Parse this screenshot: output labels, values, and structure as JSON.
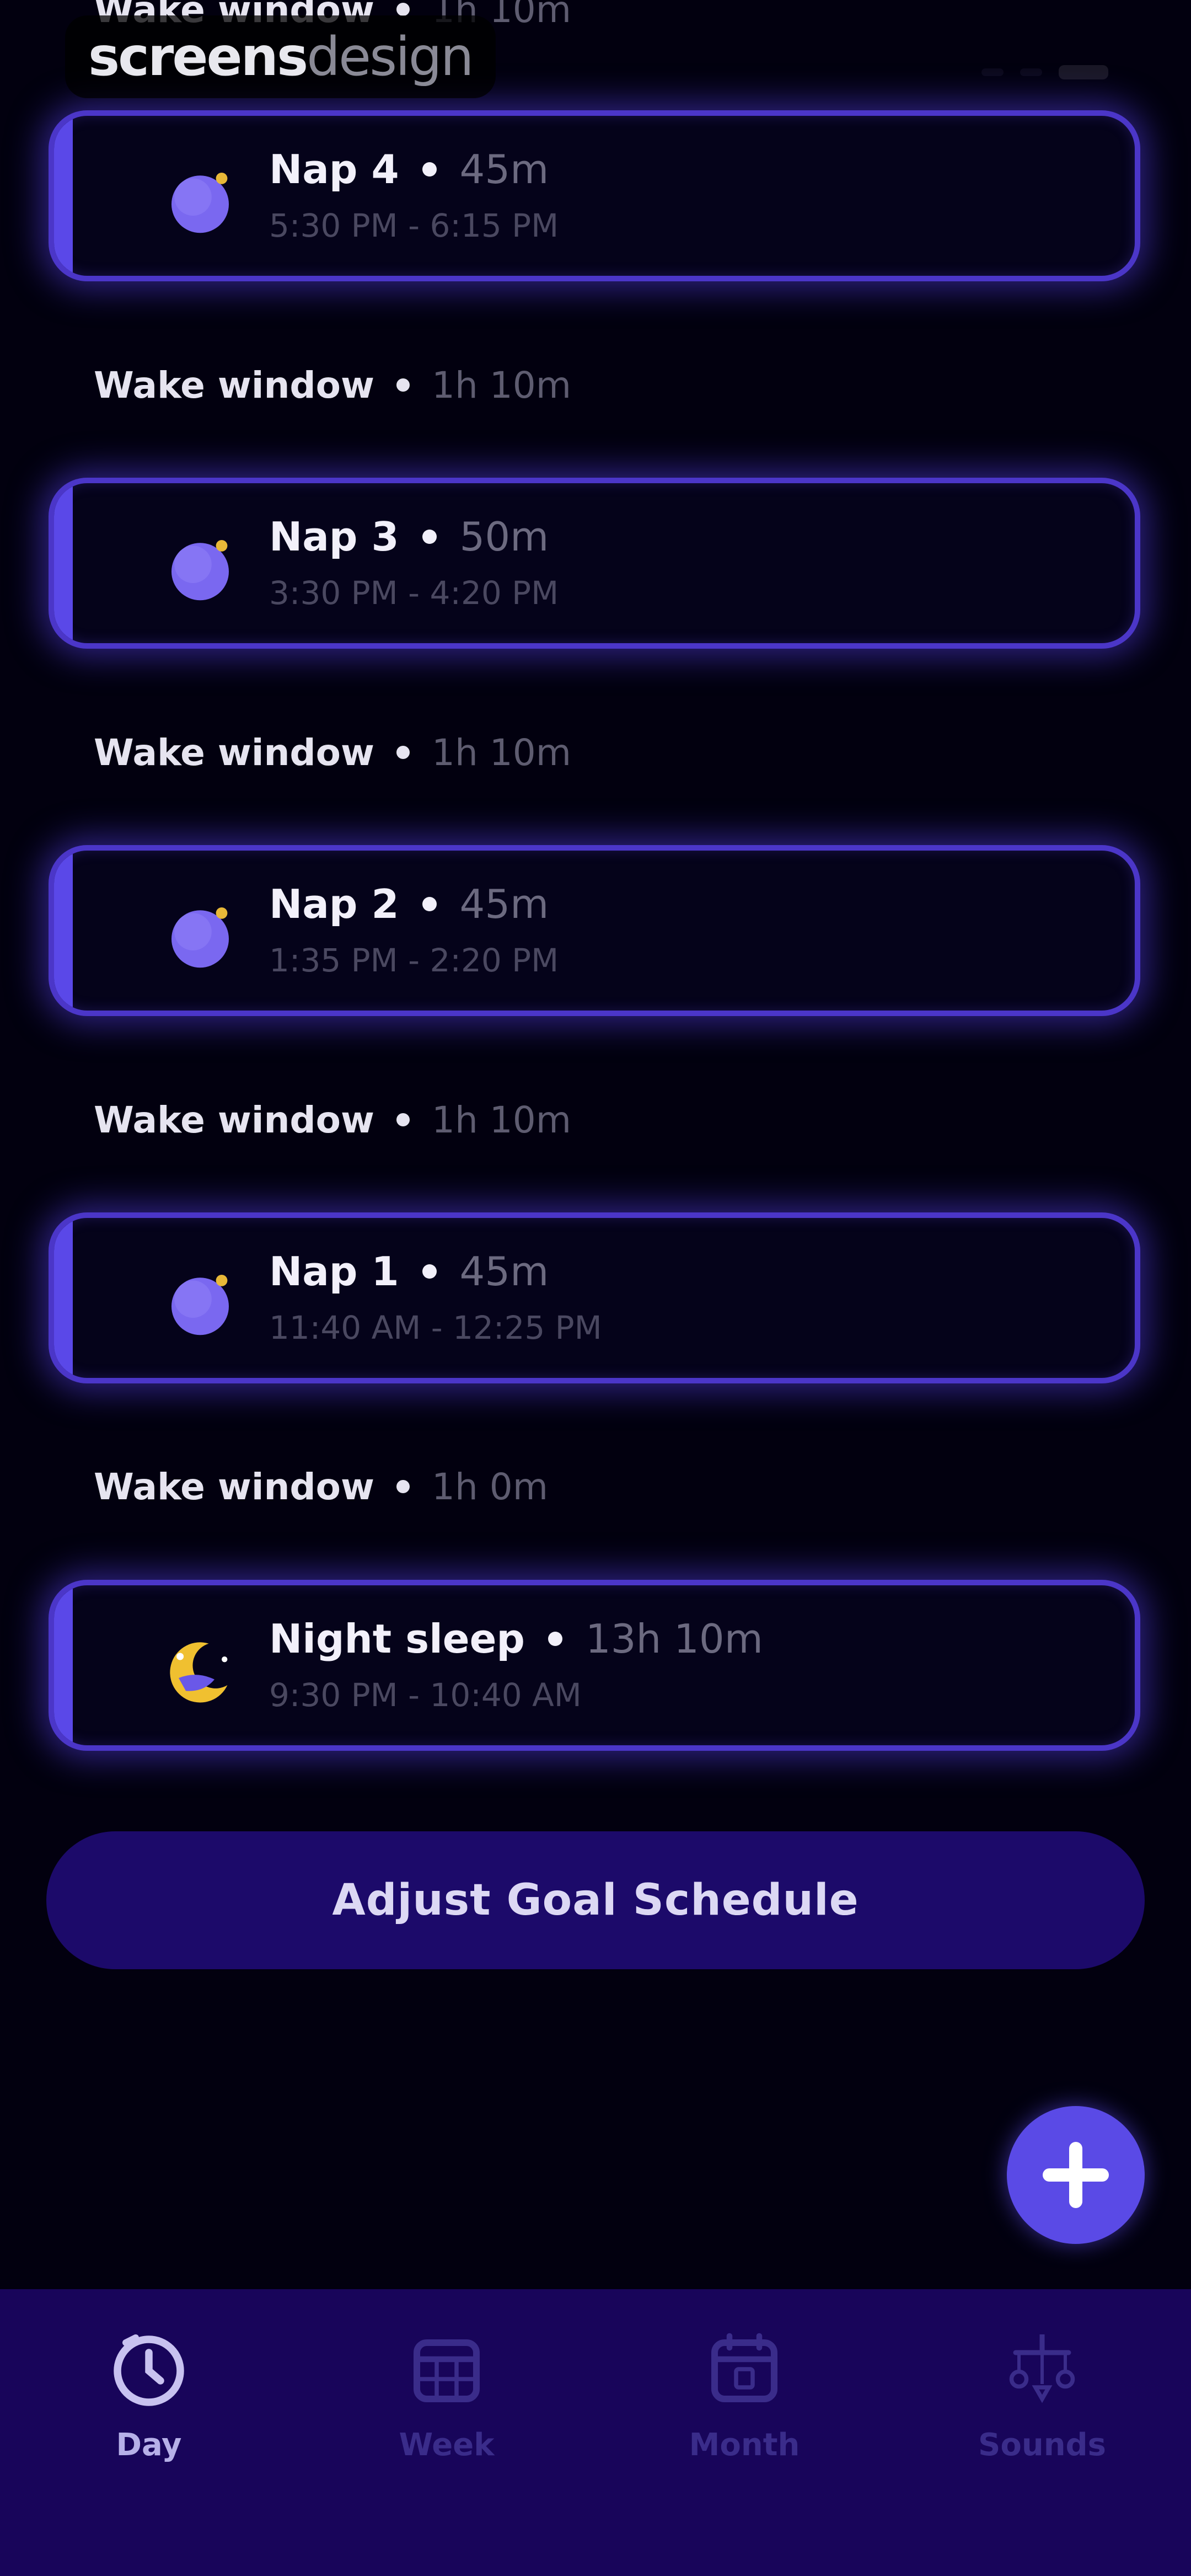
{
  "watermark": {
    "part1": "screens",
    "part2": "design"
  },
  "top_partial": {
    "label": "Wake window",
    "value": "1h 10m"
  },
  "sleep_items": [
    {
      "name": "Nap 4",
      "duration": "45m",
      "time": "5:30 PM - 6:15 PM",
      "icon": "nap-moon-icon"
    },
    {
      "name": "Nap 3",
      "duration": "50m",
      "time": "3:30 PM - 4:20 PM",
      "icon": "nap-moon-icon"
    },
    {
      "name": "Nap 2",
      "duration": "45m",
      "time": "1:35 PM - 2:20 PM",
      "icon": "nap-moon-icon"
    },
    {
      "name": "Nap 1",
      "duration": "45m",
      "time": "11:40 AM - 12:25 PM",
      "icon": "nap-moon-icon"
    },
    {
      "name": "Night sleep",
      "duration": "13h 10m",
      "time": "9:30 PM - 10:40 AM",
      "icon": "crescent-moon-icon"
    }
  ],
  "wake_windows": [
    {
      "label": "Wake window",
      "value": "1h 10m"
    },
    {
      "label": "Wake window",
      "value": "1h 10m"
    },
    {
      "label": "Wake window",
      "value": "1h 10m"
    },
    {
      "label": "Wake window",
      "value": "1h 0m"
    }
  ],
  "adjust_button": {
    "label": "Adjust Goal Schedule"
  },
  "fab": {
    "icon": "plus-icon"
  },
  "nav": {
    "items": [
      {
        "label": "Day",
        "icon": "clock-icon",
        "active": true
      },
      {
        "label": "Week",
        "icon": "week-calendar-icon",
        "active": false
      },
      {
        "label": "Month",
        "icon": "month-calendar-icon",
        "active": false
      },
      {
        "label": "Sounds",
        "icon": "mobile-toy-icon",
        "active": false
      }
    ]
  },
  "colors": {
    "background": "#02000f",
    "card_border": "#4b36c8",
    "accent": "#5a48e8",
    "button": "#1c0a6a",
    "nav_background": "#18055a",
    "fab": "#5a4ae6"
  }
}
